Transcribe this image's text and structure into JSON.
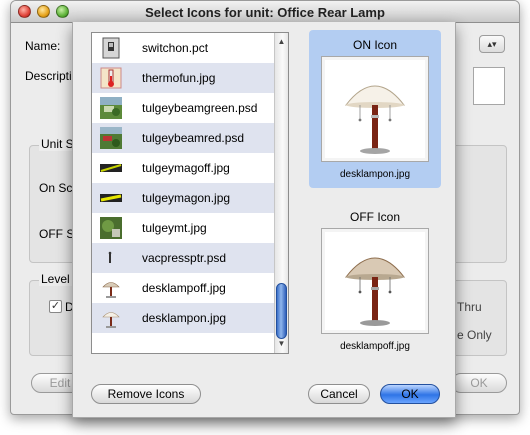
{
  "window": {
    "title": "Select Icons for unit: Office Rear Lamp",
    "bg": {
      "name_label": "Name:",
      "description_label": "Descriptio",
      "unit_section": "Unit Sc",
      "on_screen": "On Scr",
      "off_screen": "OFF Sc",
      "level_section": "Level O",
      "level_check_label": "D",
      "thru": "Thru",
      "only": "e Only",
      "edit_button": "Edit U",
      "ok_button": "OK"
    }
  },
  "sheet": {
    "files": [
      {
        "name": "switchon.pct",
        "thumb": "switch-thumbnail"
      },
      {
        "name": "thermofun.jpg",
        "thumb": "thermometer-thumbnail"
      },
      {
        "name": "tulgeybeamgreen.psd",
        "thumb": "landscape-thumbnail"
      },
      {
        "name": "tulgeybeamred.psd",
        "thumb": "landscape-thumbnail"
      },
      {
        "name": "tulgeymagoff.jpg",
        "thumb": "magnet-thumbnail"
      },
      {
        "name": "tulgeymagon.jpg",
        "thumb": "magnet-thumbnail"
      },
      {
        "name": "tulgeymt.jpg",
        "thumb": "landscape-thumbnail"
      },
      {
        "name": "vacpressptr.psd",
        "thumb": "pointer-thumbnail"
      },
      {
        "name": "desklampoff.jpg",
        "thumb": "lamp-thumbnail"
      },
      {
        "name": "desklampon.jpg",
        "thumb": "lamp-thumbnail"
      }
    ],
    "on_icon": {
      "title": "ON Icon",
      "file": "desklampon.jpg"
    },
    "off_icon": {
      "title": "OFF Icon",
      "file": "desklampoff.jpg"
    },
    "buttons": {
      "remove": "Remove Icons",
      "cancel": "Cancel",
      "ok": "OK"
    },
    "colors": {
      "selection": "#b3cdf2",
      "alt_row": "#dfe3ef",
      "accent": "#2f74e6"
    }
  }
}
